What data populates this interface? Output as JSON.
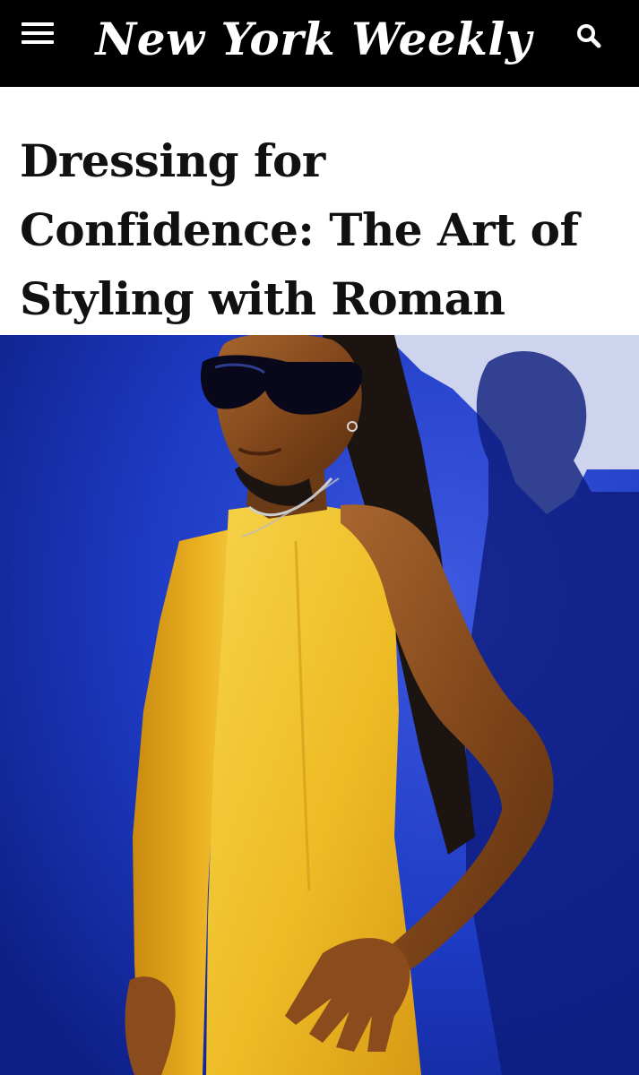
{
  "header": {
    "masthead": "New York Weekly",
    "menu_icon": "hamburger-menu-icon",
    "search_icon": "search-icon",
    "background_color": "#000000",
    "text_color": "#ffffff"
  },
  "article": {
    "headline": "Dressing for Confidence: The Art of Styling with Roman"
  },
  "hero_image": {
    "description_icon": "photo",
    "background_color": "#1a35b8",
    "outfit_color": "#f2c12e"
  }
}
